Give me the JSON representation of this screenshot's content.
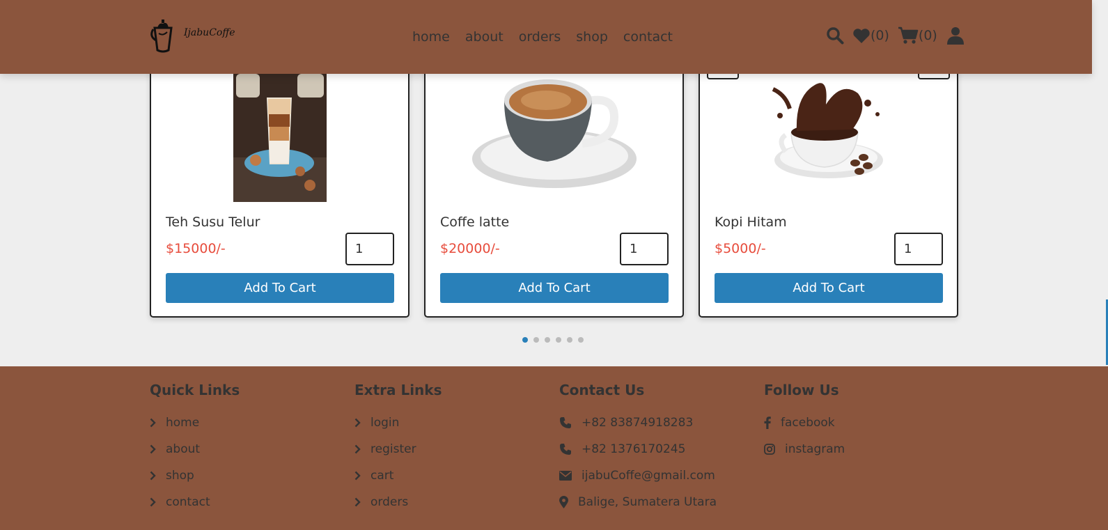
{
  "brand": {
    "name": "IjabuCoffe"
  },
  "nav": {
    "items": [
      "home",
      "about",
      "orders",
      "shop",
      "contact"
    ]
  },
  "header_icons": {
    "wishlist_count": "(0)",
    "cart_count": "(0)"
  },
  "products": [
    {
      "name": "Teh Susu Telur",
      "price": "$15000/-",
      "qty": "1",
      "button": "Add To Cart"
    },
    {
      "name": "Coffe latte",
      "price": "$20000/-",
      "qty": "1",
      "button": "Add To Cart"
    },
    {
      "name": "Kopi Hitam",
      "price": "$5000/-",
      "qty": "1",
      "button": "Add To Cart"
    }
  ],
  "pagination": {
    "count": 6,
    "active": 1
  },
  "footer": {
    "quick": {
      "title": "Quick Links",
      "links": [
        "home",
        "about",
        "shop",
        "contact"
      ]
    },
    "extra": {
      "title": "Extra Links",
      "links": [
        "login",
        "register",
        "cart",
        "orders"
      ]
    },
    "contact": {
      "title": "Contact Us",
      "items": [
        {
          "icon": "phone-icon",
          "text": "+82 83874918283"
        },
        {
          "icon": "phone-icon",
          "text": "+82 1376170245"
        },
        {
          "icon": "envelope-icon",
          "text": "ijabuCoffe@gmail.com"
        },
        {
          "icon": "map-marker-icon",
          "text": "Balige, Sumatera Utara"
        }
      ]
    },
    "follow": {
      "title": "Follow Us",
      "items": [
        {
          "icon": "facebook-icon",
          "text": "facebook"
        },
        {
          "icon": "instagram-icon",
          "text": "instagram"
        }
      ]
    }
  },
  "colors": {
    "brown": "#8b553d",
    "blue": "#2980b9",
    "price_red": "#e74c3c",
    "page_bg": "#eeeeee"
  }
}
